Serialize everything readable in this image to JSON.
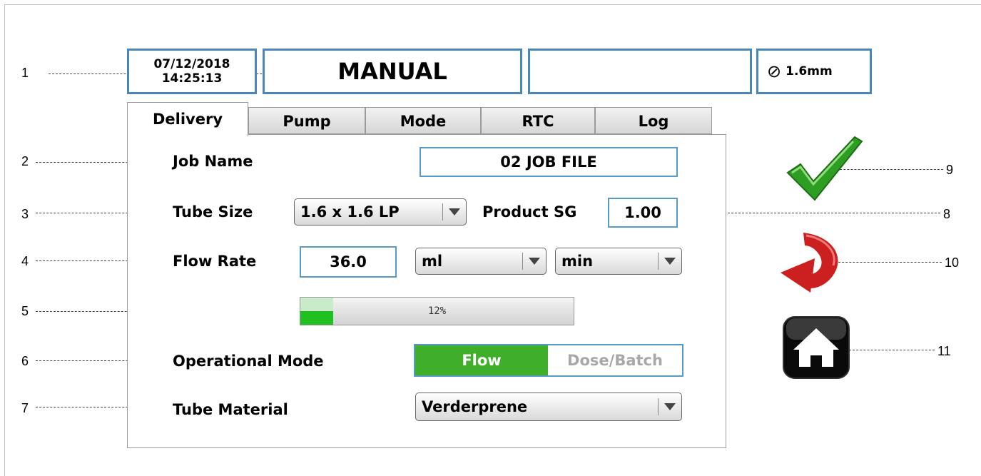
{
  "status": {
    "date": "07/12/2018",
    "time": "14:25:13",
    "mode": "MANUAL",
    "info": "",
    "tube_size": "1.6mm"
  },
  "tabs": [
    {
      "label": "Delivery",
      "active": true
    },
    {
      "label": "Pump"
    },
    {
      "label": "Mode"
    },
    {
      "label": "RTC"
    },
    {
      "label": "Log"
    }
  ],
  "form": {
    "job_name_label": "Job Name",
    "job_name_value": "02 JOB FILE",
    "tube_size_label": "Tube Size",
    "tube_size_value": "1.6 x 1.6 LP",
    "product_sg_label": "Product SG",
    "product_sg_value": "1.00",
    "flow_rate_label": "Flow Rate",
    "flow_rate_value": "36.0",
    "flow_unit": "ml",
    "flow_time_unit": "min",
    "progress_text": "12%",
    "progress_fraction": 0.12,
    "op_mode_label": "Operational Mode",
    "op_mode_on": "Flow",
    "op_mode_off": "Dose/Batch",
    "tube_material_label": "Tube Material",
    "tube_material_value": "Verderprene"
  },
  "callouts": [
    "1",
    "2",
    "3",
    "4",
    "5",
    "6",
    "7",
    "8",
    "9",
    "10",
    "11"
  ],
  "icons": {
    "confirm": "check-icon",
    "back": "return-arrow-icon",
    "home": "home-icon"
  },
  "colors": {
    "border_blue": "#4a86b8",
    "flow_green": "#3fae2a",
    "check_green": "#2e9e22",
    "arrow_red": "#cc1f1f"
  }
}
